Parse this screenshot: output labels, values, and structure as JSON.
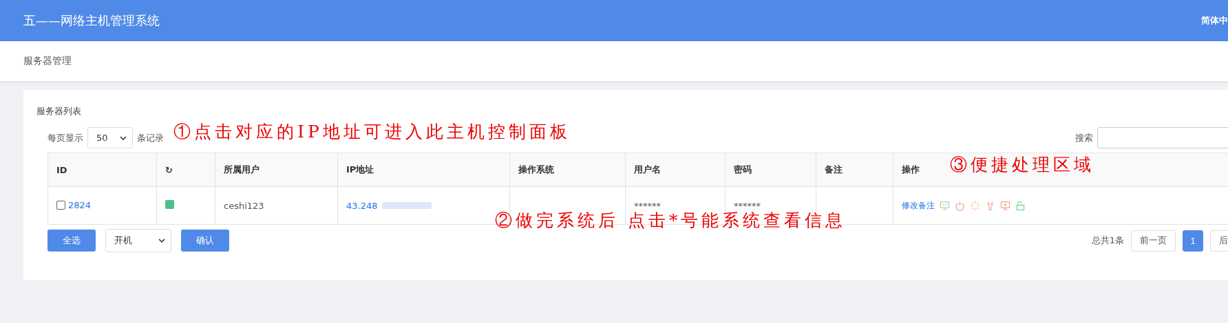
{
  "header": {
    "title": "五——网络主机管理系统",
    "language": "简体中"
  },
  "breadcrumb": "服务器管理",
  "panel": {
    "title": "服务器列表",
    "page_size": {
      "prefix": "每页显示",
      "value": "50",
      "suffix": "条记录"
    },
    "search": {
      "label": "搜索"
    },
    "table": {
      "columns": [
        "ID",
        "↻",
        "所属用户",
        "IP地址",
        "操作系统",
        "用户名",
        "密码",
        "备注",
        "操作"
      ],
      "rows": [
        {
          "checked": false,
          "id": "2824",
          "color": "#4cc18a",
          "user": "ceshi123",
          "ip": "43.248",
          "username": "******",
          "password": "******",
          "action": "修改备注"
        }
      ]
    },
    "select_all": "全选",
    "bulk_action": "开机",
    "confirm": "确认",
    "pagination": {
      "total": "总共1条",
      "prev": "前一页",
      "pages": [
        {
          "label": "1",
          "selected": true
        }
      ],
      "next": "后"
    }
  },
  "annotations": [
    "①点击对应的IP地址可进入此主机控制面板",
    "②做完系统后 点击*号能系统查看信息",
    "③便捷处理区域"
  ]
}
